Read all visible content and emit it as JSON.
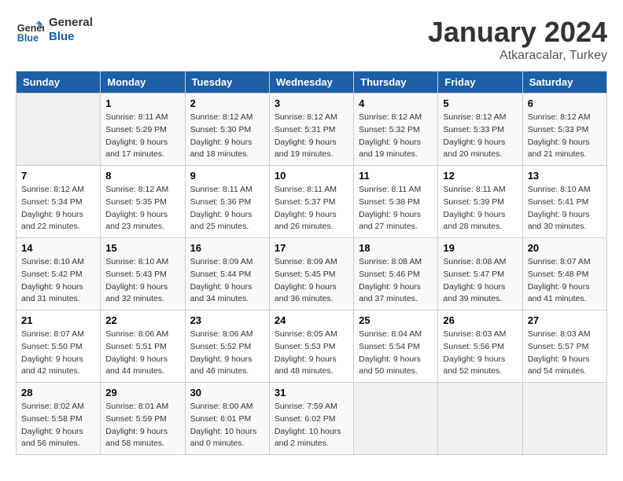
{
  "header": {
    "logo_line1": "General",
    "logo_line2": "Blue",
    "month_title": "January 2024",
    "subtitle": "Atkaracalar, Turkey"
  },
  "weekdays": [
    "Sunday",
    "Monday",
    "Tuesday",
    "Wednesday",
    "Thursday",
    "Friday",
    "Saturday"
  ],
  "weeks": [
    [
      {
        "num": "",
        "info": ""
      },
      {
        "num": "1",
        "info": "Sunrise: 8:11 AM\nSunset: 5:29 PM\nDaylight: 9 hours\nand 17 minutes."
      },
      {
        "num": "2",
        "info": "Sunrise: 8:12 AM\nSunset: 5:30 PM\nDaylight: 9 hours\nand 18 minutes."
      },
      {
        "num": "3",
        "info": "Sunrise: 8:12 AM\nSunset: 5:31 PM\nDaylight: 9 hours\nand 19 minutes."
      },
      {
        "num": "4",
        "info": "Sunrise: 8:12 AM\nSunset: 5:32 PM\nDaylight: 9 hours\nand 19 minutes."
      },
      {
        "num": "5",
        "info": "Sunrise: 8:12 AM\nSunset: 5:33 PM\nDaylight: 9 hours\nand 20 minutes."
      },
      {
        "num": "6",
        "info": "Sunrise: 8:12 AM\nSunset: 5:33 PM\nDaylight: 9 hours\nand 21 minutes."
      }
    ],
    [
      {
        "num": "7",
        "info": "Sunrise: 8:12 AM\nSunset: 5:34 PM\nDaylight: 9 hours\nand 22 minutes."
      },
      {
        "num": "8",
        "info": "Sunrise: 8:12 AM\nSunset: 5:35 PM\nDaylight: 9 hours\nand 23 minutes."
      },
      {
        "num": "9",
        "info": "Sunrise: 8:11 AM\nSunset: 5:36 PM\nDaylight: 9 hours\nand 25 minutes."
      },
      {
        "num": "10",
        "info": "Sunrise: 8:11 AM\nSunset: 5:37 PM\nDaylight: 9 hours\nand 26 minutes."
      },
      {
        "num": "11",
        "info": "Sunrise: 8:11 AM\nSunset: 5:38 PM\nDaylight: 9 hours\nand 27 minutes."
      },
      {
        "num": "12",
        "info": "Sunrise: 8:11 AM\nSunset: 5:39 PM\nDaylight: 9 hours\nand 28 minutes."
      },
      {
        "num": "13",
        "info": "Sunrise: 8:10 AM\nSunset: 5:41 PM\nDaylight: 9 hours\nand 30 minutes."
      }
    ],
    [
      {
        "num": "14",
        "info": "Sunrise: 8:10 AM\nSunset: 5:42 PM\nDaylight: 9 hours\nand 31 minutes."
      },
      {
        "num": "15",
        "info": "Sunrise: 8:10 AM\nSunset: 5:43 PM\nDaylight: 9 hours\nand 32 minutes."
      },
      {
        "num": "16",
        "info": "Sunrise: 8:09 AM\nSunset: 5:44 PM\nDaylight: 9 hours\nand 34 minutes."
      },
      {
        "num": "17",
        "info": "Sunrise: 8:09 AM\nSunset: 5:45 PM\nDaylight: 9 hours\nand 36 minutes."
      },
      {
        "num": "18",
        "info": "Sunrise: 8:08 AM\nSunset: 5:46 PM\nDaylight: 9 hours\nand 37 minutes."
      },
      {
        "num": "19",
        "info": "Sunrise: 8:08 AM\nSunset: 5:47 PM\nDaylight: 9 hours\nand 39 minutes."
      },
      {
        "num": "20",
        "info": "Sunrise: 8:07 AM\nSunset: 5:48 PM\nDaylight: 9 hours\nand 41 minutes."
      }
    ],
    [
      {
        "num": "21",
        "info": "Sunrise: 8:07 AM\nSunset: 5:50 PM\nDaylight: 9 hours\nand 42 minutes."
      },
      {
        "num": "22",
        "info": "Sunrise: 8:06 AM\nSunset: 5:51 PM\nDaylight: 9 hours\nand 44 minutes."
      },
      {
        "num": "23",
        "info": "Sunrise: 8:06 AM\nSunset: 5:52 PM\nDaylight: 9 hours\nand 46 minutes."
      },
      {
        "num": "24",
        "info": "Sunrise: 8:05 AM\nSunset: 5:53 PM\nDaylight: 9 hours\nand 48 minutes."
      },
      {
        "num": "25",
        "info": "Sunrise: 8:04 AM\nSunset: 5:54 PM\nDaylight: 9 hours\nand 50 minutes."
      },
      {
        "num": "26",
        "info": "Sunrise: 8:03 AM\nSunset: 5:56 PM\nDaylight: 9 hours\nand 52 minutes."
      },
      {
        "num": "27",
        "info": "Sunrise: 8:03 AM\nSunset: 5:57 PM\nDaylight: 9 hours\nand 54 minutes."
      }
    ],
    [
      {
        "num": "28",
        "info": "Sunrise: 8:02 AM\nSunset: 5:58 PM\nDaylight: 9 hours\nand 56 minutes."
      },
      {
        "num": "29",
        "info": "Sunrise: 8:01 AM\nSunset: 5:59 PM\nDaylight: 9 hours\nand 58 minutes."
      },
      {
        "num": "30",
        "info": "Sunrise: 8:00 AM\nSunset: 6:01 PM\nDaylight: 10 hours\nand 0 minutes."
      },
      {
        "num": "31",
        "info": "Sunrise: 7:59 AM\nSunset: 6:02 PM\nDaylight: 10 hours\nand 2 minutes."
      },
      {
        "num": "",
        "info": ""
      },
      {
        "num": "",
        "info": ""
      },
      {
        "num": "",
        "info": ""
      }
    ]
  ]
}
